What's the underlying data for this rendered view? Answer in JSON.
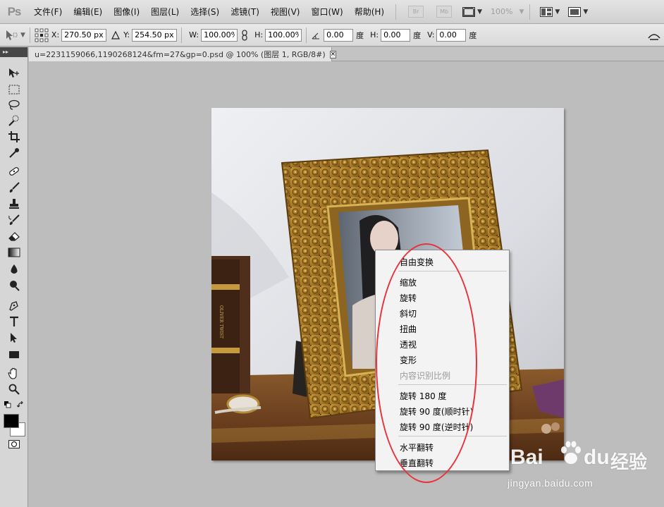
{
  "app": {
    "logo": "Ps"
  },
  "menubar": {
    "items": [
      "文件(F)",
      "编辑(E)",
      "图像(I)",
      "图层(L)",
      "选择(S)",
      "滤镜(T)",
      "视图(V)",
      "窗口(W)",
      "帮助(H)"
    ],
    "bridge": "Br",
    "minibridge": "Mb",
    "zoom": "100%"
  },
  "options": {
    "x_label": "X:",
    "x_value": "270.50 px",
    "y_label": "Y:",
    "y_value": "254.50 px",
    "w_label": "W:",
    "w_value": "100.00%",
    "h_label": "H:",
    "h_value": "100.00%",
    "angle_value": "0.00",
    "angle_unit": "度",
    "hskew_label": "H:",
    "hskew_value": "0.00",
    "hskew_unit": "度",
    "vskew_label": "V:",
    "vskew_value": "0.00",
    "vskew_unit": "度"
  },
  "document": {
    "tab_title": "u=2231159066,1190268124&fm=27&gp=0.psd  @  100% (图层 1, RGB/8#)",
    "close": "×"
  },
  "context_menu": {
    "items": [
      {
        "label": "自由变换",
        "enabled": true
      },
      {
        "label": "缩放",
        "enabled": true
      },
      {
        "label": "旋转",
        "enabled": true
      },
      {
        "label": "斜切",
        "enabled": true
      },
      {
        "label": "扭曲",
        "enabled": true
      },
      {
        "label": "透视",
        "enabled": true
      },
      {
        "label": "变形",
        "enabled": true
      },
      {
        "label": "内容识别比例",
        "enabled": false
      },
      {
        "label": "旋转 180 度",
        "enabled": true
      },
      {
        "label": "旋转 90 度(顺时针)",
        "enabled": true
      },
      {
        "label": "旋转 90 度(逆时针)",
        "enabled": true
      },
      {
        "label": "水平翻转",
        "enabled": true
      },
      {
        "label": "垂直翻转",
        "enabled": true
      }
    ]
  },
  "image": {
    "book_text": "OLIVER TWIST"
  },
  "watermark": {
    "brand": "Bai",
    "brand2": "du",
    "brand3": "经验",
    "url": "jingyan.baidu.com"
  },
  "colors": {
    "highlight": "#e8323a",
    "foreground": "#000000",
    "background": "#ffffff"
  }
}
